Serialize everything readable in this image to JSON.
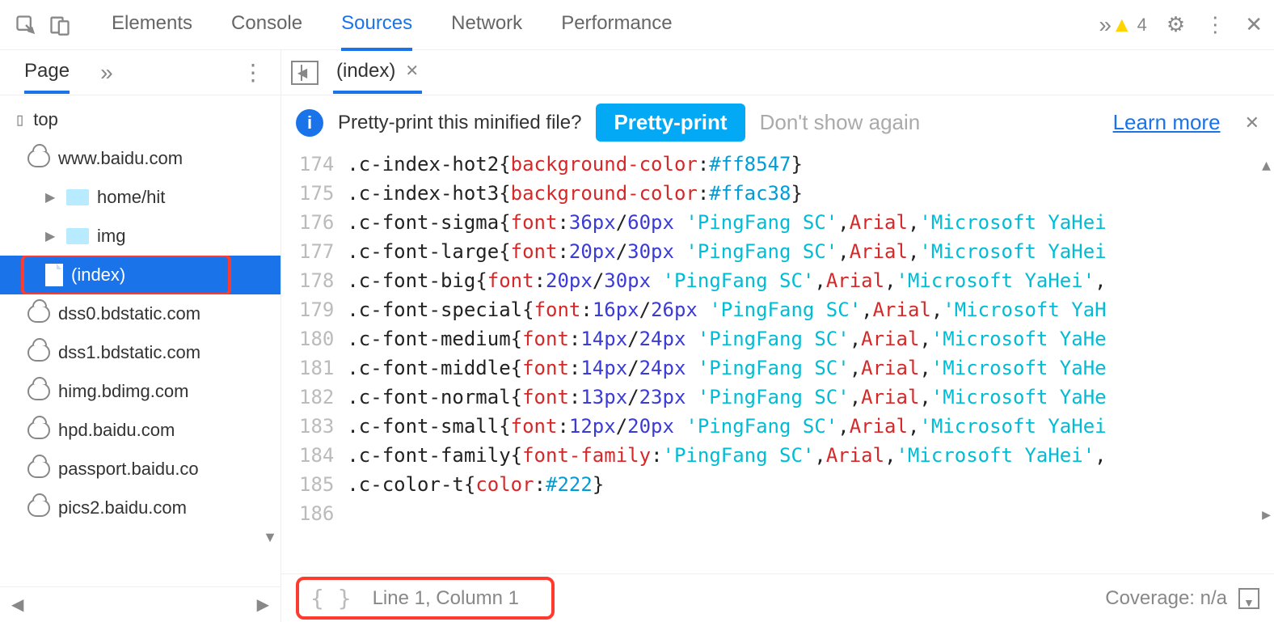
{
  "topbar": {
    "tabs": [
      "Elements",
      "Console",
      "Sources",
      "Network",
      "Performance"
    ],
    "active_index": 2,
    "warning_count": "4"
  },
  "sidebar": {
    "tab_label": "Page",
    "tree": {
      "root": "top",
      "domain": "www.baidu.com",
      "folders": [
        "home/hit",
        "img"
      ],
      "selected_file": "(index)",
      "clouds": [
        "dss0.bdstatic.com",
        "dss1.bdstatic.com",
        "himg.bdimg.com",
        "hpd.baidu.com",
        "passport.baidu.co",
        "pics2.baidu.com"
      ]
    }
  },
  "editor": {
    "tab_label": "(index)",
    "infobar": {
      "message": "Pretty-print this minified file?",
      "button": "Pretty-print",
      "dont_show": "Don't show again",
      "learn_more": "Learn more"
    },
    "status": {
      "position": "Line 1, Column 1",
      "coverage": "Coverage: n/a"
    },
    "code": [
      {
        "n": 174,
        "sel": ".c-index-hot2",
        "prop": "background-color",
        "val_hex": "#ff8547"
      },
      {
        "n": 175,
        "sel": ".c-index-hot3",
        "prop": "background-color",
        "val_hex": "#ffac38"
      },
      {
        "n": 176,
        "sel": ".c-font-sigma",
        "prop": "font",
        "size": "36px",
        "lh": "60px",
        "fonts": [
          "'PingFang SC'",
          "Arial",
          "'Microsoft YaHei"
        ]
      },
      {
        "n": 177,
        "sel": ".c-font-large",
        "prop": "font",
        "size": "20px",
        "lh": "30px",
        "fonts": [
          "'PingFang SC'",
          "Arial",
          "'Microsoft YaHei"
        ]
      },
      {
        "n": 178,
        "sel": ".c-font-big",
        "prop": "font",
        "size": "20px",
        "lh": "30px",
        "fonts": [
          "'PingFang SC'",
          "Arial",
          "'Microsoft YaHei'",
          ""
        ]
      },
      {
        "n": 179,
        "sel": ".c-font-special",
        "prop": "font",
        "size": "16px",
        "lh": "26px",
        "fonts": [
          "'PingFang SC'",
          "Arial",
          "'Microsoft YaH"
        ]
      },
      {
        "n": 180,
        "sel": ".c-font-medium",
        "prop": "font",
        "size": "14px",
        "lh": "24px",
        "fonts": [
          "'PingFang SC'",
          "Arial",
          "'Microsoft YaHe"
        ]
      },
      {
        "n": 181,
        "sel": ".c-font-middle",
        "prop": "font",
        "size": "14px",
        "lh": "24px",
        "fonts": [
          "'PingFang SC'",
          "Arial",
          "'Microsoft YaHe"
        ]
      },
      {
        "n": 182,
        "sel": ".c-font-normal",
        "prop": "font",
        "size": "13px",
        "lh": "23px",
        "fonts": [
          "'PingFang SC'",
          "Arial",
          "'Microsoft YaHe"
        ]
      },
      {
        "n": 183,
        "sel": ".c-font-small",
        "prop": "font",
        "size": "12px",
        "lh": "20px",
        "fonts": [
          "'PingFang SC'",
          "Arial",
          "'Microsoft YaHei"
        ]
      },
      {
        "n": 184,
        "sel": ".c-font-family",
        "prop": "font-family",
        "fonts": [
          "'PingFang SC'",
          "Arial",
          "'Microsoft YaHei'",
          ""
        ]
      },
      {
        "n": 185,
        "sel": ".c-color-t",
        "prop": "color",
        "val_hex": "#222"
      },
      {
        "n": 186,
        "sel": "",
        "raw": ""
      }
    ]
  }
}
